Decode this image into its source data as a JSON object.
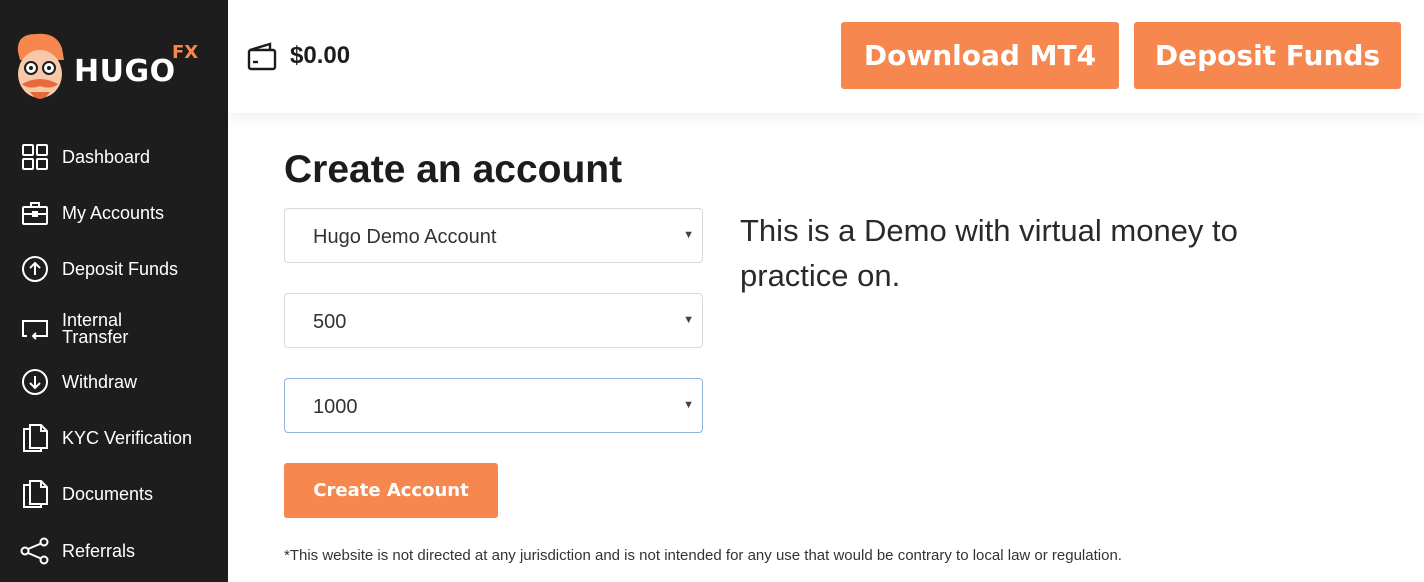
{
  "brand": {
    "name": "HUGO",
    "suffix": "FX",
    "accent": "#f5874f",
    "sidebar_bg": "#1d1d1d"
  },
  "sidebar": {
    "items": [
      {
        "label": "Dashboard",
        "icon": "grid-icon"
      },
      {
        "label": "My Accounts",
        "icon": "briefcase-icon"
      },
      {
        "label": "Deposit Funds",
        "icon": "arrow-up-circle-icon"
      },
      {
        "label": "Internal Transfer",
        "icon": "transfer-icon"
      },
      {
        "label": "Withdraw",
        "icon": "arrow-down-circle-icon"
      },
      {
        "label": "KYC Verification",
        "icon": "document-icon"
      },
      {
        "label": "Documents",
        "icon": "documents-icon"
      },
      {
        "label": "Referrals",
        "icon": "share-icon"
      }
    ]
  },
  "header": {
    "wallet_icon": "wallet-icon",
    "balance": "$0.00",
    "download_label": "Download MT4",
    "deposit_label": "Deposit Funds"
  },
  "main": {
    "title": "Create an account",
    "account_type": "Hugo Demo Account",
    "leverage": "500",
    "amount": "1000",
    "info": "This is a Demo with virtual money to practice on.",
    "create_label": "Create Account",
    "disclaimer": "*This website is not directed at any jurisdiction and is not intended for any use that would be contrary to local law or regulation."
  }
}
